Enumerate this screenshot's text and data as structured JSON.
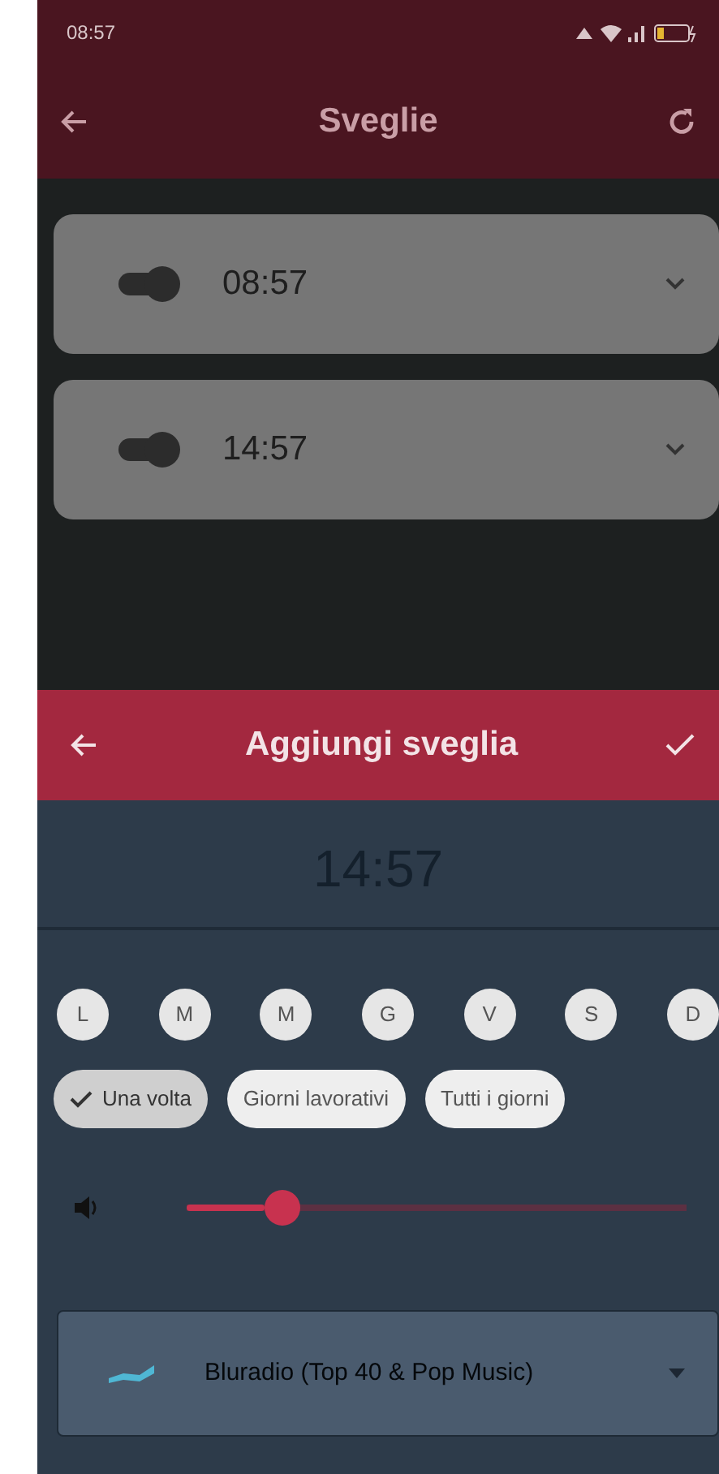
{
  "status_bar": {
    "time": "08:57"
  },
  "app_bar": {
    "title": "Sveglie"
  },
  "alarms": [
    {
      "time": "08:57",
      "on": true,
      "expanded": false
    },
    {
      "time": "14:57",
      "on": true,
      "expanded": false
    }
  ],
  "sheet": {
    "title": "Aggiungi sveglia",
    "time": "14:57",
    "days": [
      {
        "label": "L",
        "selected": false
      },
      {
        "label": "M",
        "selected": false
      },
      {
        "label": "M",
        "selected": false
      },
      {
        "label": "G",
        "selected": false
      },
      {
        "label": "V",
        "selected": false
      },
      {
        "label": "S",
        "selected": false
      },
      {
        "label": "D",
        "selected": false
      }
    ],
    "repeat": [
      {
        "label": "Una volta",
        "selected": true
      },
      {
        "label": "Giorni lavorativi",
        "selected": false
      },
      {
        "label": "Tutti i giorni",
        "selected": false
      }
    ],
    "volume": {
      "level": 0.19
    },
    "station": {
      "name": "Bluradio (Top 40 & Pop Music)"
    }
  }
}
